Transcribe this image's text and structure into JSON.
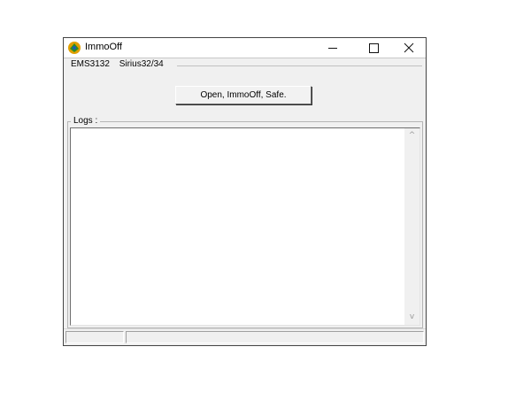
{
  "window": {
    "title": "ImmoOff"
  },
  "titlebar": {
    "min_icon": "minimize-icon",
    "max_icon": "maximize-icon",
    "close_icon": "close-icon"
  },
  "tabs": [
    {
      "label": "EMS3132"
    },
    {
      "label": "Sirius32/34"
    }
  ],
  "main": {
    "action_button_label": "Open, ImmoOff, Safe."
  },
  "logs": {
    "label": "Logs :"
  },
  "scrollbar": {
    "up_glyph": "^",
    "down_glyph": "v"
  },
  "statusbar": {
    "panes": [
      "",
      ""
    ]
  },
  "colors": {
    "window_bg": "#f0f0f0",
    "log_bg": "#ffffff"
  }
}
